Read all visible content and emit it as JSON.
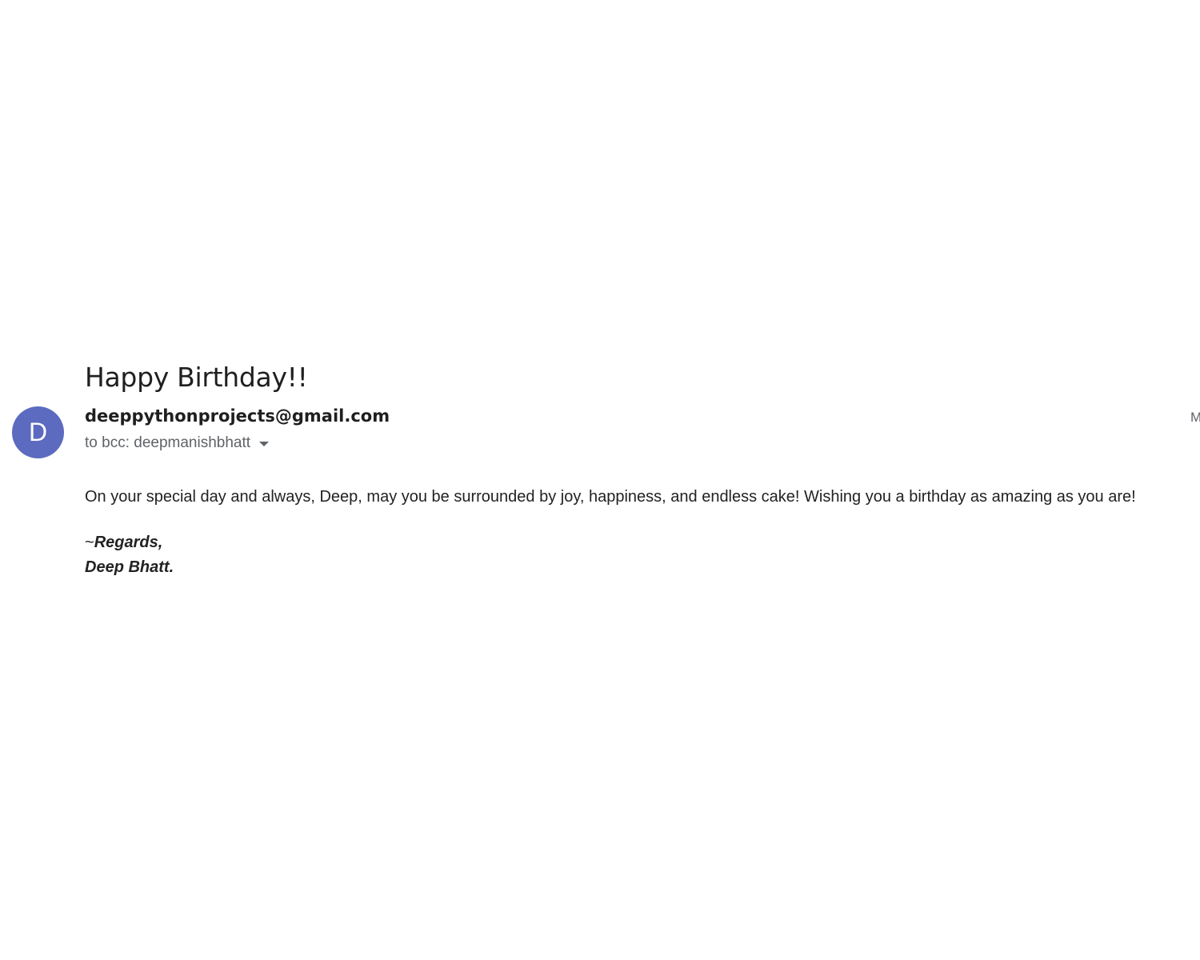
{
  "email": {
    "subject": "Happy Birthday!!",
    "avatar_letter": "D",
    "avatar_color": "#5c6bc0",
    "sender": "deeppythonprojects@gmail.com",
    "recipients": "to bcc: deepmanishbhatt",
    "date_partial": "M",
    "body": "On your special day and always, Deep, may you be surrounded by joy, happiness, and endless cake! Wishing you a birthday as amazing as you are!",
    "signature": {
      "tilde": "~",
      "regards": "Regards,",
      "name": "Deep Bhatt."
    }
  }
}
